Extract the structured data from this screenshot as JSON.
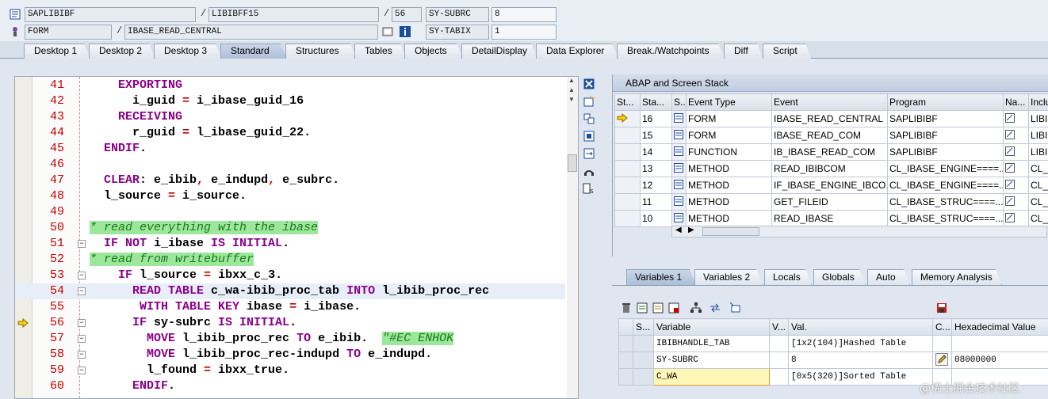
{
  "header": {
    "program": "SAPLIBIBF",
    "include": "LIBIBFF15",
    "line": "56",
    "subrc_label": "SY-SUBRC",
    "subrc_value": "8",
    "event_type": "FORM",
    "event": "IBASE_READ_CENTRAL",
    "tabix_label": "SY-TABIX",
    "tabix_value": "1",
    "sep1": "/",
    "sep2": "/",
    "sep3": "/"
  },
  "tabs": [
    "Desktop 1",
    "Desktop 2",
    "Desktop 3",
    "Standard",
    "Structures",
    "Tables",
    "Objects",
    "DetailDisplay",
    "Data Explorer",
    "Break./Watchpoints",
    "Diff",
    "Script"
  ],
  "active_tab": "Standard",
  "code": [
    {
      "no": "41",
      "parts": [
        [
          "sp",
          "    "
        ],
        [
          "kw",
          "EXPORTING"
        ]
      ]
    },
    {
      "no": "42",
      "parts": [
        [
          "sp",
          "      "
        ],
        [
          "tx",
          "i_guid "
        ],
        [
          "op",
          "="
        ],
        [
          "tx",
          " i_ibase_guid_16"
        ]
      ]
    },
    {
      "no": "43",
      "parts": [
        [
          "sp",
          "    "
        ],
        [
          "kw",
          "RECEIVING"
        ]
      ]
    },
    {
      "no": "44",
      "parts": [
        [
          "sp",
          "      "
        ],
        [
          "tx",
          "r_guid "
        ],
        [
          "op",
          "="
        ],
        [
          "tx",
          " l_ibase_guid_22."
        ]
      ]
    },
    {
      "no": "45",
      "parts": [
        [
          "sp",
          "  "
        ],
        [
          "kw",
          "ENDIF"
        ],
        [
          "tx",
          "."
        ]
      ]
    },
    {
      "no": "46",
      "parts": []
    },
    {
      "no": "47",
      "parts": [
        [
          "sp",
          "  "
        ],
        [
          "kw",
          "CLEAR"
        ],
        [
          "tx",
          ": e_ibib"
        ],
        [
          "op",
          ","
        ],
        [
          "tx",
          " e_indupd"
        ],
        [
          "op",
          ","
        ],
        [
          "tx",
          " e_subrc."
        ]
      ]
    },
    {
      "no": "48",
      "parts": [
        [
          "sp",
          "  "
        ],
        [
          "tx",
          "l_source "
        ],
        [
          "op",
          "="
        ],
        [
          "tx",
          " i_source."
        ]
      ]
    },
    {
      "no": "49",
      "parts": []
    },
    {
      "no": "50",
      "parts": [
        [
          "cm",
          "* read everything with the ibase"
        ]
      ]
    },
    {
      "no": "51",
      "parts": [
        [
          "sp",
          "  "
        ],
        [
          "kw",
          "IF NOT"
        ],
        [
          "tx",
          " i_ibase "
        ],
        [
          "kw",
          "IS INITIAL"
        ],
        [
          "tx",
          "."
        ]
      ]
    },
    {
      "no": "52",
      "parts": [
        [
          "cm",
          "* read from writebuffer"
        ]
      ]
    },
    {
      "no": "53",
      "parts": [
        [
          "sp",
          "    "
        ],
        [
          "kw",
          "IF"
        ],
        [
          "tx",
          " l_source "
        ],
        [
          "op",
          "="
        ],
        [
          "tx",
          " ibxx_c_3."
        ]
      ]
    },
    {
      "no": "54",
      "parts": [
        [
          "sp",
          "      "
        ],
        [
          "kw",
          "READ TABLE"
        ],
        [
          "tx",
          " c_wa-ibib_proc_tab "
        ],
        [
          "kw",
          "INTO"
        ],
        [
          "tx",
          " l_ibib_proc_rec"
        ]
      ]
    },
    {
      "no": "55",
      "parts": [
        [
          "sp",
          "       "
        ],
        [
          "kw",
          "WITH TABLE KEY"
        ],
        [
          "tx",
          " ibase "
        ],
        [
          "op",
          "="
        ],
        [
          "tx",
          " i_ibase."
        ]
      ]
    },
    {
      "no": "56",
      "parts": [
        [
          "sp",
          "      "
        ],
        [
          "kw",
          "IF"
        ],
        [
          "tx",
          " sy-subrc "
        ],
        [
          "kw",
          "IS INITIAL"
        ],
        [
          "tx",
          "."
        ]
      ]
    },
    {
      "no": "57",
      "parts": [
        [
          "sp",
          "        "
        ],
        [
          "kw",
          "MOVE"
        ],
        [
          "tx",
          " l_ibib_proc_rec "
        ],
        [
          "kw",
          "TO"
        ],
        [
          "tx",
          " e_ibib.  "
        ],
        [
          "cm",
          "\"#EC ENHOK"
        ]
      ]
    },
    {
      "no": "58",
      "parts": [
        [
          "sp",
          "        "
        ],
        [
          "kw",
          "MOVE"
        ],
        [
          "tx",
          " l_ibib_proc_rec-indupd "
        ],
        [
          "kw",
          "TO"
        ],
        [
          "tx",
          " e_indupd."
        ]
      ]
    },
    {
      "no": "59",
      "parts": [
        [
          "sp",
          "        "
        ],
        [
          "tx",
          "l_found "
        ],
        [
          "op",
          "="
        ],
        [
          "tx",
          " ibxx_true."
        ]
      ]
    },
    {
      "no": "60",
      "parts": [
        [
          "sp",
          "      "
        ],
        [
          "kw",
          "ENDIF"
        ],
        [
          "tx",
          "."
        ]
      ]
    }
  ],
  "stack": {
    "title": "ABAP and Screen Stack",
    "columns": [
      "St...",
      "Sta...",
      "S...",
      "Event Type",
      "Event",
      "Program",
      "Na...",
      "Inclu"
    ],
    "rows": [
      {
        "level": "16",
        "type": "FORM",
        "event": "IBASE_READ_CENTRAL",
        "program": "SAPLIBIBF",
        "include": "LIBI",
        "current": true
      },
      {
        "level": "15",
        "type": "FORM",
        "event": "IBASE_READ_COM",
        "program": "SAPLIBIBF",
        "include": "LIBI",
        "current": false
      },
      {
        "level": "14",
        "type": "FUNCTION",
        "event": "IB_IBASE_READ_COM",
        "program": "SAPLIBIBF",
        "include": "LIBI",
        "current": false
      },
      {
        "level": "13",
        "type": "METHOD",
        "event": "READ_IBIBCOM",
        "program": "CL_IBASE_ENGINE====...",
        "include": "CL_I",
        "current": false
      },
      {
        "level": "12",
        "type": "METHOD",
        "event": "IF_IBASE_ENGINE_IBCO...",
        "program": "CL_IBASE_ENGINE====...",
        "include": "CL_I",
        "current": false
      },
      {
        "level": "11",
        "type": "METHOD",
        "event": "GET_FILEID",
        "program": "CL_IBASE_STRUC====...",
        "include": "CL_I",
        "current": false
      },
      {
        "level": "10",
        "type": "METHOD",
        "event": "READ_IBASE",
        "program": "CL_IBASE_STRUC====...",
        "include": "CL_I",
        "current": false
      }
    ]
  },
  "variables": {
    "tabs": [
      "Variables 1",
      "Variables 2",
      "Locals",
      "Globals",
      "Auto",
      "Memory Analysis"
    ],
    "active_tab": "Variables 1",
    "columns": [
      "S...",
      "Variable",
      "V...",
      "Val.",
      "C...",
      "Hexadecimal Value"
    ],
    "rows": [
      {
        "name": "IBIBHANDLE_TAB",
        "value": "[1x2(104)]Hashed Table",
        "hex": ""
      },
      {
        "name": "SY-SUBRC",
        "value": "8",
        "hex": "08000000"
      },
      {
        "name": "C_WA",
        "value": "[0x5(320)]Sorted Table",
        "hex": ""
      }
    ]
  },
  "watermark": "@稀土掘金技术社区"
}
